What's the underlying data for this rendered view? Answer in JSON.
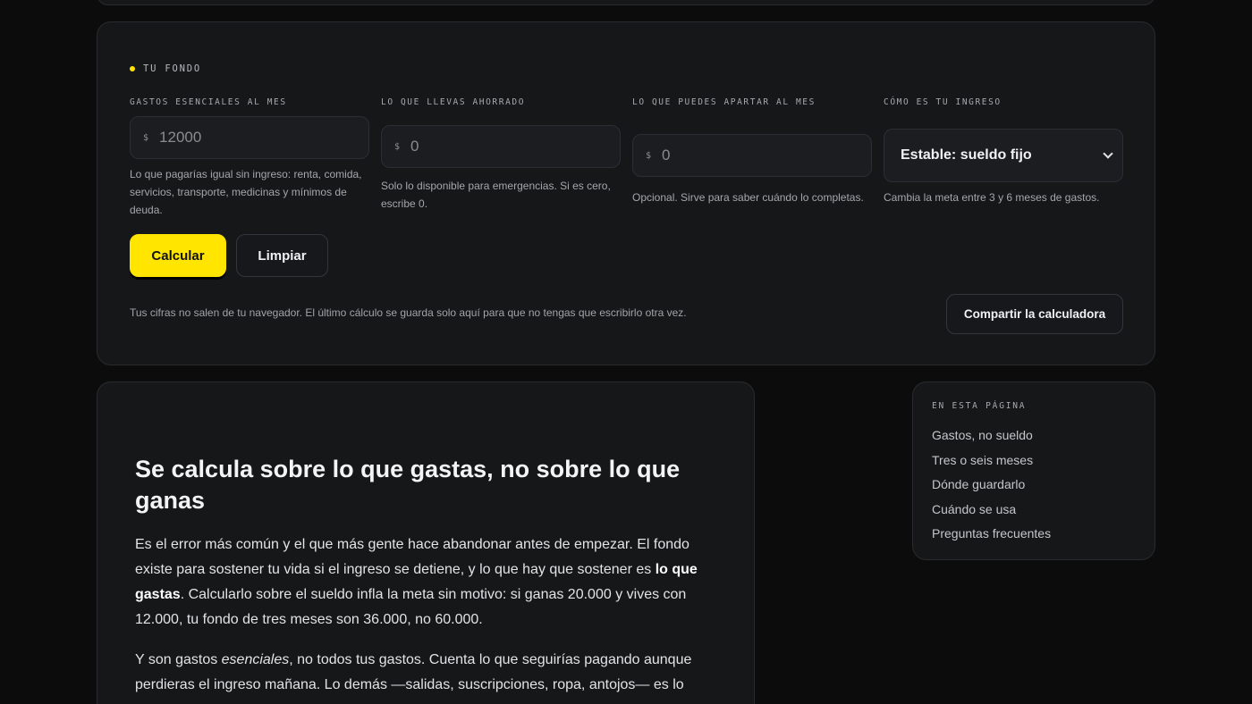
{
  "form": {
    "eyebrow": "TU FONDO",
    "fields": [
      {
        "label": "GASTOS ESENCIALES AL MES",
        "currency": "$",
        "value": "",
        "placeholder": "12000",
        "help": "Lo que pagarías igual sin ingreso: renta, comida, servicios, transporte, medicinas y mínimos de deuda."
      },
      {
        "label": "LO QUE LLEVAS AHORRADO",
        "currency": "$",
        "value": "",
        "placeholder": "0",
        "help": "Solo lo disponible para emergencias. Si es cero, escribe 0."
      },
      {
        "label": "LO QUE PUEDES APARTAR AL MES",
        "currency": "$",
        "value": "",
        "placeholder": "0",
        "help": "Opcional. Sirve para saber cuándo lo completas."
      },
      {
        "label": "CÓMO ES TU INGRESO",
        "selected": "Estable: sueldo fijo",
        "help": "Cambia la meta entre 3 y 6 meses de gastos."
      }
    ],
    "calculate_label": "Calcular",
    "clear_label": "Limpiar",
    "privacy_note": "Tus cifras no salen de tu navegador. El último cálculo se guarda solo aquí para que no tengas que escribirlo otra vez.",
    "share_label": "Compartir la calculadora"
  },
  "article": {
    "heading": "Se calcula sobre lo que gastas, no sobre lo que ganas",
    "p1_before": "Es el error más común y el que más gente hace abandonar antes de empezar. El fondo existe para sostener tu vida si el ingreso se detiene, y lo que hay que sostener es ",
    "p1_bold": "lo que gastas",
    "p1_after": ". Calcularlo sobre el sueldo infla la meta sin motivo: si ganas 20.000 y vives con 12.000, tu fondo de tres meses son 36.000, no 60.000.",
    "p2_before": "Y son gastos ",
    "p2_em": "esenciales",
    "p2_after": ", no todos tus gastos. Cuenta lo que seguirías pagando aunque perdieras el ingreso mañana. Lo demás —salidas, suscripciones, ropa, antojos— es lo"
  },
  "toc": {
    "title": "EN ESTA PÁGINA",
    "items": [
      "Gastos, no sueldo",
      "Tres o seis meses",
      "Dónde guardarlo",
      "Cuándo se usa",
      "Preguntas frecuentes"
    ]
  },
  "colors": {
    "accent": "#ffe500",
    "background": "#0c0c0d",
    "card": "#161719"
  }
}
